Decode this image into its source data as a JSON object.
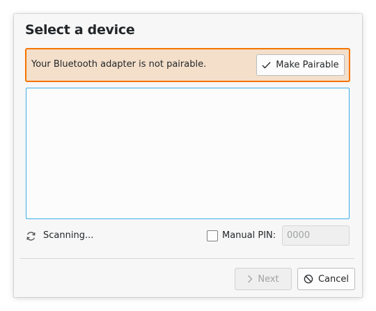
{
  "dialog": {
    "title": "Select a device"
  },
  "banner": {
    "message": "Your Bluetooth adapter is not pairable.",
    "button_label": "Make Pairable",
    "button_icon": "checkmark-icon",
    "border_color": "#f67400",
    "background_color": "#f4dfca"
  },
  "device_list": {
    "items": []
  },
  "status": {
    "icon": "refresh-icon",
    "label": "Scanning..."
  },
  "manual_pin": {
    "label": "Manual PIN:",
    "checked": false,
    "placeholder": "0000",
    "value": ""
  },
  "buttons": {
    "next_label": "Next",
    "next_icon": "chevron-right-icon",
    "next_enabled": false,
    "cancel_label": "Cancel",
    "cancel_icon": "cancel-icon"
  },
  "colors": {
    "accent": "#3daee9"
  }
}
